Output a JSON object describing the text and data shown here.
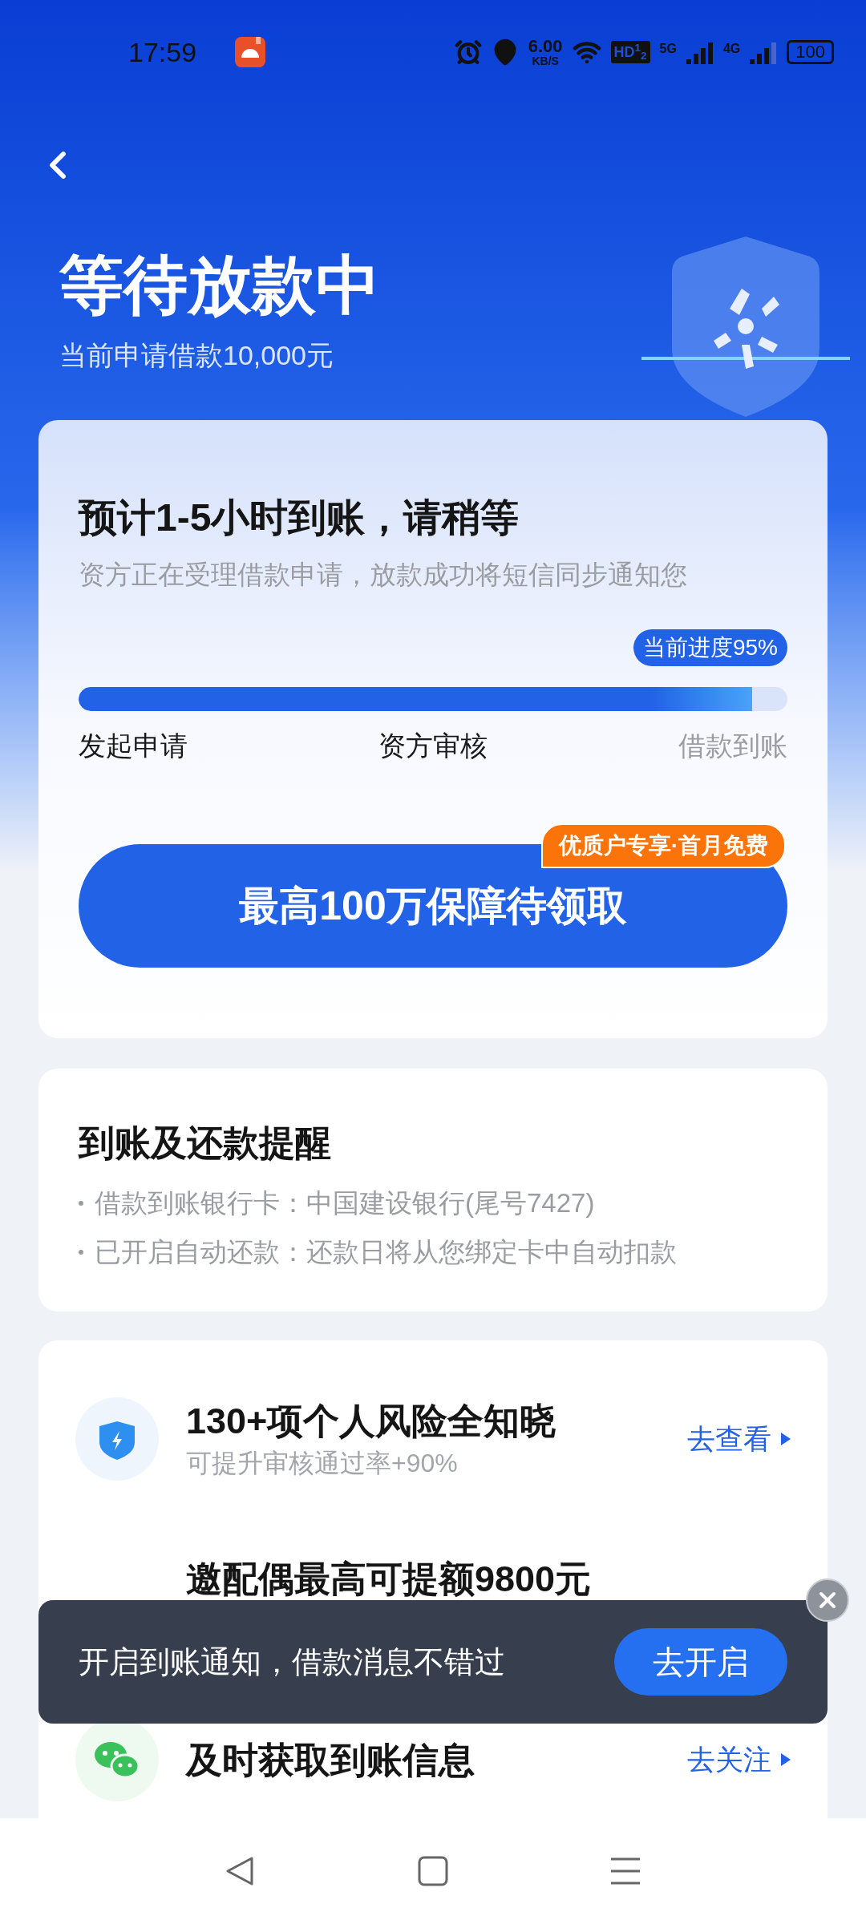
{
  "status_bar": {
    "time": "17:59",
    "speed": "6.00",
    "speed_unit": "KB/S",
    "hd": "HD$^{1}$$_{2}$",
    "net_1": "5G",
    "net_2": "4G",
    "battery": "100"
  },
  "header": {
    "title": "等待放款中",
    "subtitle": "当前申请借款10,000元"
  },
  "progress_card": {
    "title": "预计1-5小时到账，请稍等",
    "subtitle": "资方正在受理借款申请，放款成功将短信同步通知您",
    "badge": "当前进度95%",
    "level": 0.95,
    "steps": [
      {
        "label": "发起申请",
        "done": true
      },
      {
        "label": "资方审核",
        "done": true
      },
      {
        "label": "借款到账",
        "done": false
      }
    ],
    "button": "最高100万保障待领取",
    "tag": "优质户专享·首月免费"
  },
  "reminder_card": {
    "title": "到账及还款提醒",
    "items": [
      "借款到账银行卡：中国建设银行(尾号7427)",
      "已开启自动还款：还款日将从您绑定卡中自动扣款"
    ]
  },
  "services": [
    {
      "kind": "shield",
      "title": "130+项个人风险全知晓",
      "subtitle": "可提升审核通过率+90%",
      "action": "去查看"
    },
    {
      "kind": "hidden",
      "title": "邀配偶最高可提额9800元"
    },
    {
      "kind": "wechat",
      "title": "及时获取到账信息",
      "action": "去关注"
    }
  ],
  "toast": {
    "text": "开启到账通知，借款消息不错过",
    "button": "去开启"
  }
}
